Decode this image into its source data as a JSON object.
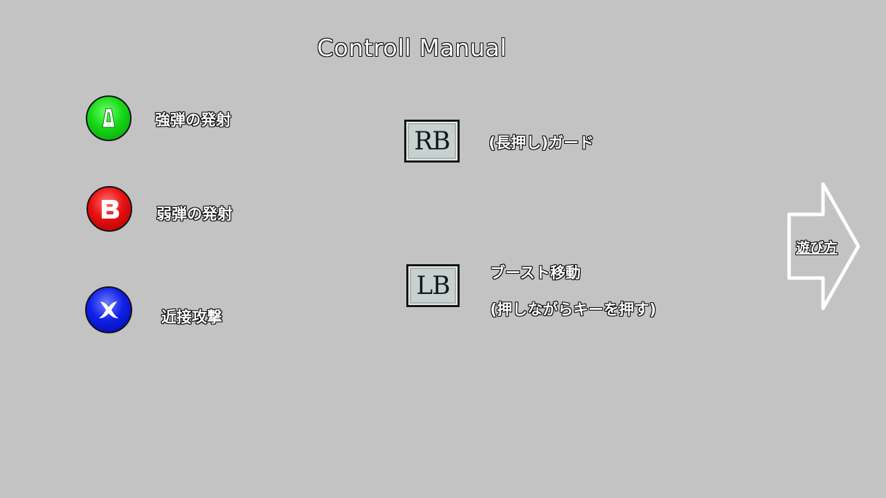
{
  "title": "Controll Manual",
  "controls": {
    "a": {
      "icon": "a-button-icon",
      "color": "#16d816",
      "label": "強弾の発射"
    },
    "b": {
      "icon": "b-button-icon",
      "color": "#e81010",
      "label": "弱弾の発射"
    },
    "x": {
      "icon": "x-button-icon",
      "color": "#1020e8",
      "label": "近接攻撃"
    },
    "rb": {
      "key": "RB",
      "label": "(長押し)ガード"
    },
    "lb": {
      "key": "LB",
      "label_line1": "ブースト移動",
      "label_line2": "(押しながらキーを押す)"
    }
  },
  "next": {
    "icon": "right-arrow-icon",
    "label": "遊び方"
  },
  "colors": {
    "background": "#c3c3c3",
    "text": "#ffffff",
    "outline": "#000000"
  }
}
